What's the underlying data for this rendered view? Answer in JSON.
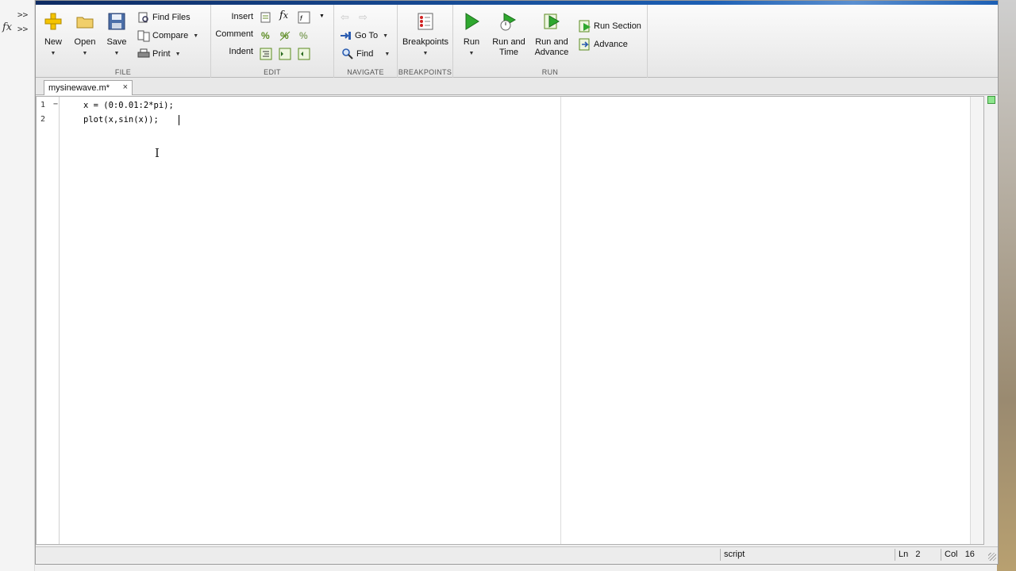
{
  "left_strip": {
    "fx_symbol": "fx",
    "chevrons": [
      ">>",
      ">>"
    ]
  },
  "toolstrip": {
    "file": {
      "label": "FILE",
      "new_label": "New",
      "open_label": "Open",
      "save_label": "Save",
      "find_files_label": "Find Files",
      "compare_label": "Compare",
      "print_label": "Print"
    },
    "edit": {
      "label": "EDIT",
      "insert_label": "Insert",
      "comment_label": "Comment",
      "indent_label": "Indent"
    },
    "navigate": {
      "label": "NAVIGATE",
      "goto_label": "Go To",
      "find_label": "Find"
    },
    "breakpoints": {
      "label": "BREAKPOINTS",
      "breakpoints_label": "Breakpoints"
    },
    "run": {
      "label": "RUN",
      "run_label": "Run",
      "run_and_time_label": [
        "Run and",
        "Time"
      ],
      "run_and_advance_label": [
        "Run and",
        "Advance"
      ],
      "run_section_label": "Run Section",
      "advance_label": "Advance"
    }
  },
  "editor": {
    "tab_label": "mysinewave.m*",
    "tab_close": "×",
    "lines": [
      {
        "num": "1",
        "marker": "−",
        "text": "x = (0:0.01:2*pi);"
      },
      {
        "num": "2",
        "marker": "",
        "text": "plot(x,sin(x));"
      }
    ]
  },
  "status_bar": {
    "mode": "script",
    "ln_label": "Ln",
    "ln_value": "2",
    "col_label": "Col",
    "col_value": "16"
  },
  "icons": {
    "new": "plus-icon",
    "open": "folder-icon",
    "save": "floppy-icon",
    "run": "play-icon"
  },
  "colors": {
    "run_green": "#2fa82f",
    "title_blue": "#1c5fb4",
    "new_yellow": "#f5c400"
  }
}
